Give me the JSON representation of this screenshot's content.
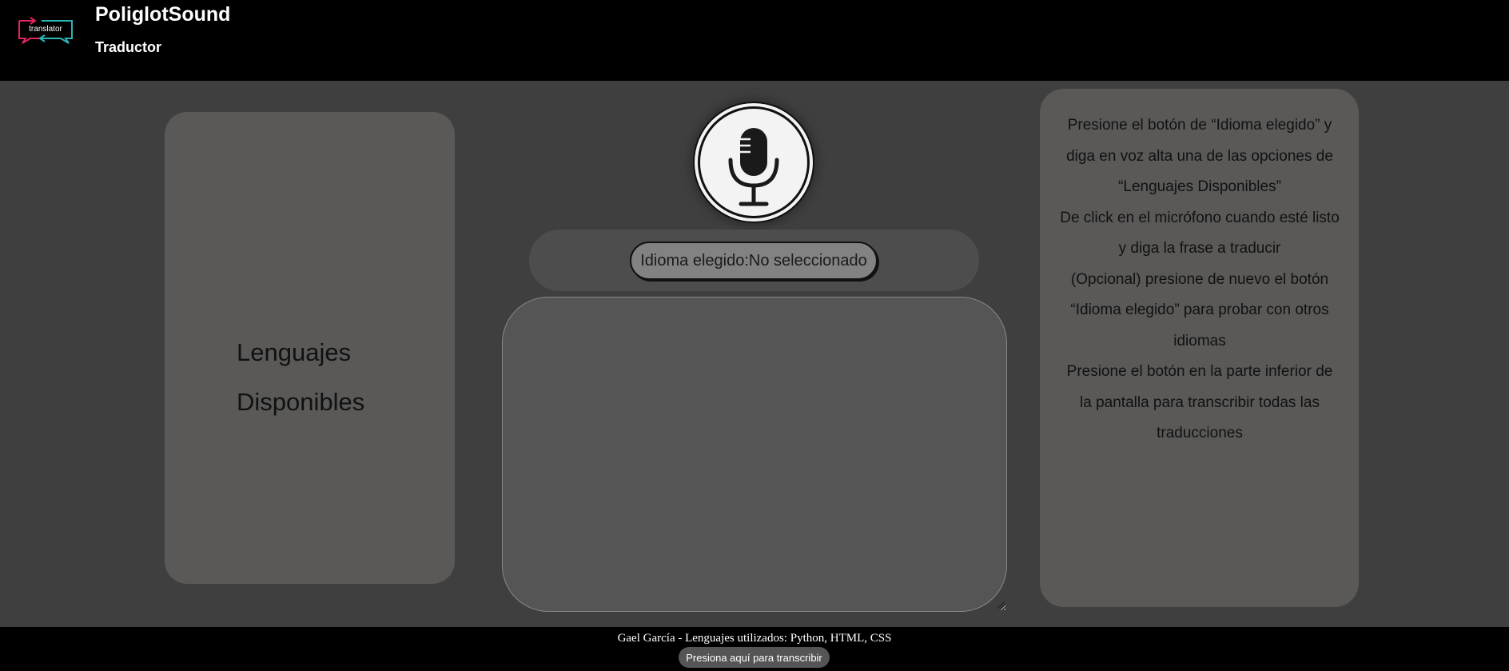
{
  "header": {
    "logo_text": "translator",
    "title": "PoliglotSound",
    "subtitle": "Traductor"
  },
  "languages_panel": {
    "title": "Lenguajes Disponibles"
  },
  "microphone": {
    "icon": "microphone-icon"
  },
  "language_selector": {
    "label": "Idioma elegido:No seleccionado"
  },
  "output": {
    "value": ""
  },
  "instructions": {
    "text": "Presione el botón de “Idioma elegido” y diga en voz alta una de las opciones de “Lenguajes Disponibles”\nDe click en el micrófono cuando esté listo y diga la frase a traducir\n(Opcional) presione de nuevo el botón “Idioma elegido” para probar con otros idiomas\nPresione el botón en la parte inferior de la pantalla para transcribir todas las traducciones"
  },
  "footer": {
    "credits": "Gael García - Lenguajes utilizados: Python, HTML, CSS",
    "transcribe_label": "Presiona aquí para transcribir"
  },
  "colors": {
    "background": "#3f3f3f",
    "header": "#000000",
    "panel": "#5a5958",
    "logo_pink": "#e0245e",
    "logo_teal": "#2bb5b5"
  }
}
